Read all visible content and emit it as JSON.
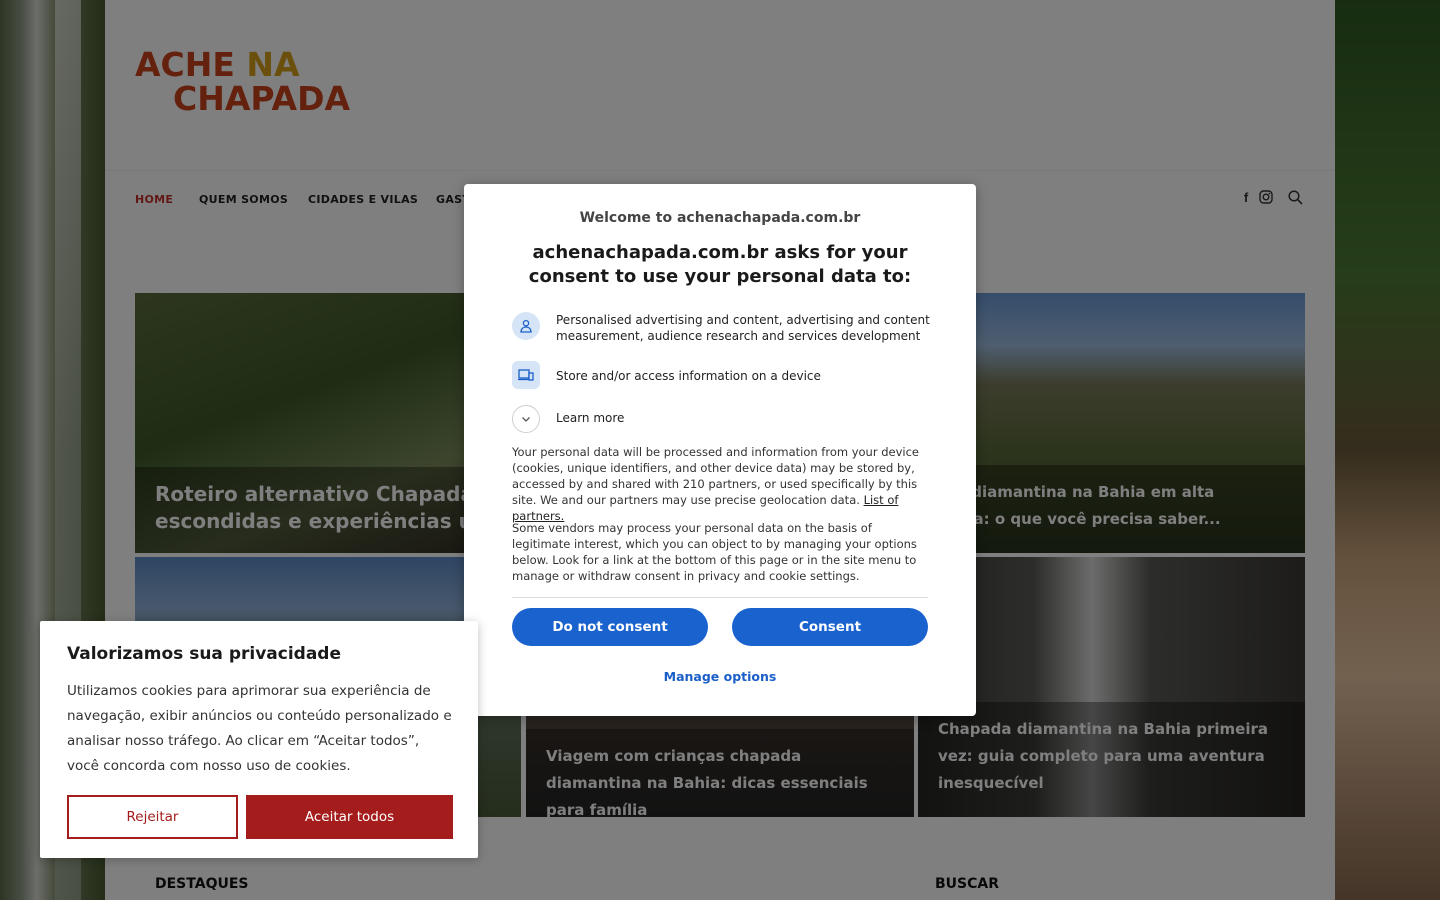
{
  "site": {
    "logo_line1_a": "ACHE ",
    "logo_line1_b": "NA",
    "logo_line2": "CHAPADA"
  },
  "nav": {
    "items": [
      {
        "label": "HOME",
        "active": true
      },
      {
        "label": "QUEM SOMOS"
      },
      {
        "label": "CIDADES E VILAS"
      },
      {
        "label": "GAST"
      }
    ],
    "icons": [
      "facebook-icon",
      "instagram-icon",
      "search-icon"
    ]
  },
  "posts": [
    {
      "title": "Roteiro alternativo Chapada D escondidas e experiências úni"
    },
    {
      "title": "ada diamantina na Bahia em alta orada: o que você precisa saber..."
    },
    {
      "title": "Viagem com crianças chapada diamantina na Bahia: dicas essenciais para família"
    },
    {
      "title": "Chapada diamantina na Bahia primeira vez: guia completo para uma aventura inesquecível"
    }
  ],
  "sections": {
    "destaques": "DESTAQUES",
    "buscar": "BUSCAR"
  },
  "consent_modal": {
    "welcome": "Welcome to achenachapada.com.br",
    "heading": "achenachapada.com.br asks for your consent to use your personal data to:",
    "purpose1": "Personalised advertising and content, advertising and content measurement, audience research and services development",
    "purpose2": "Store and/or access information on a device",
    "learn_more": "Learn more",
    "para1": "Your personal data will be processed and information from your device (cookies, unique identifiers, and other device data) may be stored by, accessed by and shared with 210 partners, or used specifically by this site. We and our partners may use precise geolocation data.",
    "partners_link": "List of partners.",
    "para2": "Some vendors may process your personal data on the basis of legitimate interest, which you can object to by managing your options below. Look for a link at the bottom of this page or in the site menu to manage or withdraw consent in privacy and cookie settings.",
    "do_not_consent": "Do not consent",
    "consent": "Consent",
    "manage_options": "Manage options"
  },
  "cookie_banner": {
    "title": "Valorizamos sua privacidade",
    "body": "Utilizamos cookies para aprimorar sua experiência de navegação, exibir anúncios ou conteúdo personalizado e analisar nosso tráfego. Ao clicar em “Aceitar todos”, você concorda com nosso uso de cookies.",
    "reject": "Rejeitar",
    "accept_all": "Aceitar todos"
  },
  "colors": {
    "accent_red": "#a51c1c",
    "consent_blue": "#1a63cf",
    "logo_orange": "#c9441d",
    "logo_gold": "#d6a11b"
  }
}
